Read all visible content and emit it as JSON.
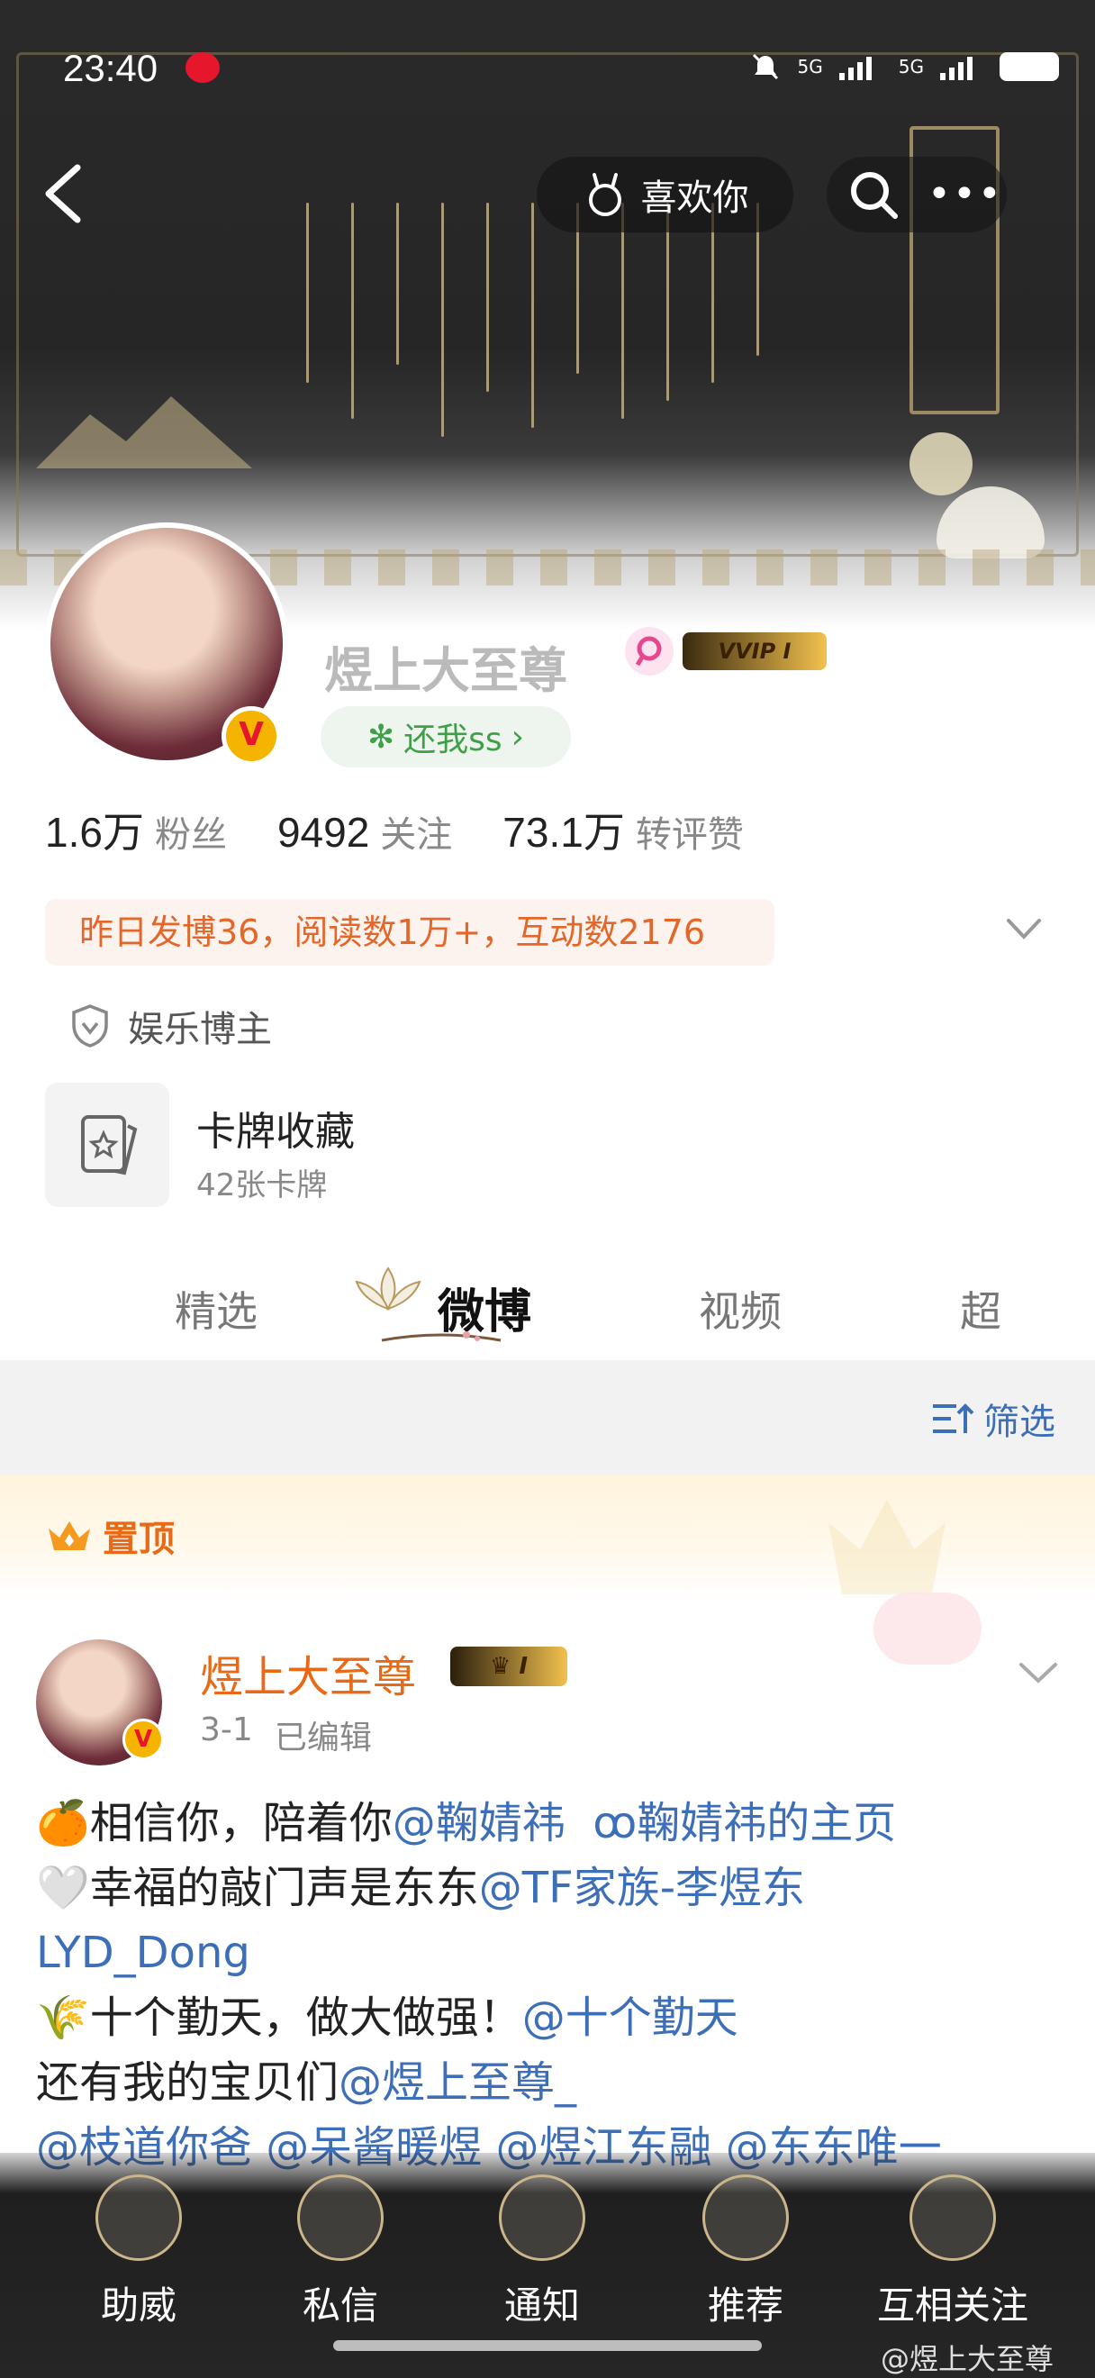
{
  "status_bar": {
    "time": "23:40",
    "network_1": "5G",
    "network_2": "5G"
  },
  "header": {
    "like_label": "喜欢你"
  },
  "profile": {
    "username": "煜上大至尊",
    "vip_badge": "VVIP Ⅰ",
    "fan_club": "还我ss",
    "verified_badge": "V",
    "stats": [
      {
        "value": "1.6万",
        "label": "粉丝"
      },
      {
        "value": "9492",
        "label": "关注"
      },
      {
        "value": "73.1万",
        "label": "转评赞"
      }
    ],
    "activity": "昨日发博36，阅读数1万+，互动数2176",
    "category": "娱乐博主",
    "card_collection": {
      "title": "卡牌收藏",
      "subtitle": "42张卡牌"
    }
  },
  "tabs": [
    {
      "label": "精选",
      "active": false
    },
    {
      "label": "微博",
      "active": true
    },
    {
      "label": "视频",
      "active": false
    },
    {
      "label": "超",
      "active": false
    }
  ],
  "filter": {
    "label": "筛选"
  },
  "pinned": {
    "label": "置顶",
    "post": {
      "author": "煜上大至尊",
      "vip_badge": "Ⅰ",
      "date": "3-1",
      "edited": "已编辑",
      "lines": [
        {
          "emoji": "🍊",
          "text": "相信你，陪着你",
          "mention": "@鞠婧祎",
          "extra": "ꝏ鞠婧祎的主页"
        },
        {
          "emoji": "🤍",
          "text": "幸福的敲门声是东东",
          "mention": "@TF家族-李煜东",
          "extra": ""
        },
        {
          "emoji": "",
          "text": "",
          "mention": "LYD_Dong",
          "extra": ""
        },
        {
          "emoji": "🌾",
          "text": "十个勤天，做大做强！",
          "mention": "@十个勤天",
          "extra": ""
        },
        {
          "emoji": "",
          "text": "还有我的宝贝们",
          "mention": "@煜上至尊_",
          "extra": ""
        },
        {
          "emoji": "",
          "text": "",
          "mention": "@枝道你爸 @呆酱暖煜 @煜江东融 @东东唯一",
          "extra": ""
        }
      ]
    }
  },
  "bottom_bar": [
    {
      "label": "助威",
      "icon": "fox-mask-icon"
    },
    {
      "label": "私信",
      "icon": "scroll-icon"
    },
    {
      "label": "通知",
      "icon": "bell-icon"
    },
    {
      "label": "推荐",
      "icon": "compass-icon"
    },
    {
      "label": "互相关注",
      "icon": "lotus-icon"
    }
  ],
  "watermark": "@煜上大至尊",
  "colors": {
    "accent_orange": "#e86a17",
    "link_blue": "#3d6fb8",
    "weibo_red": "#e6162d",
    "gold": "#f4b400"
  }
}
